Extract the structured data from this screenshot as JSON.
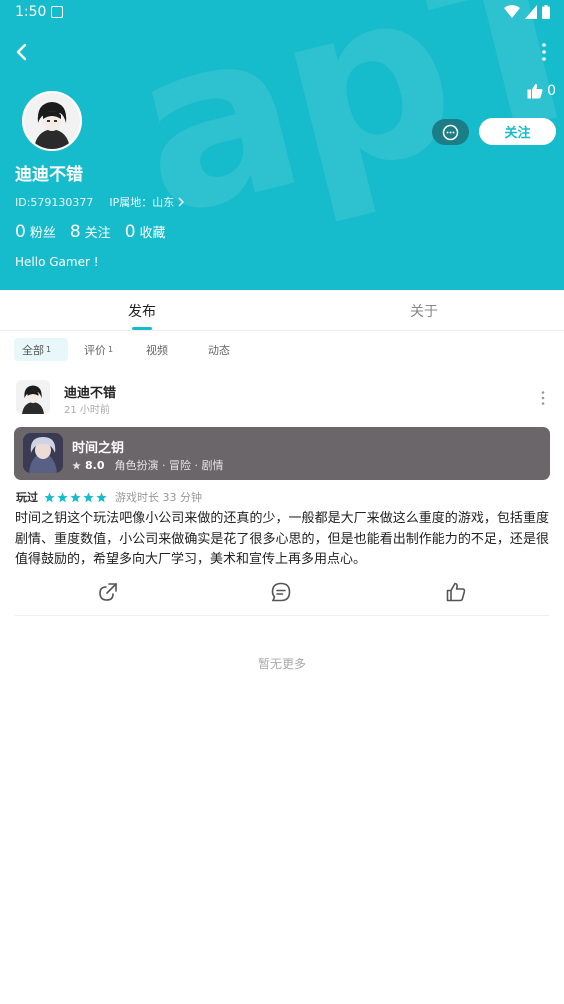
{
  "status_bar": {
    "time": "1:50"
  },
  "header": {
    "watermark": "apTap",
    "likes_count": "0",
    "follow_label": "关注",
    "username": "迪迪不错",
    "id_text": "ID:579130377",
    "ip_text": "IP属地：山东",
    "stats": [
      {
        "value": "0",
        "label": "粉丝"
      },
      {
        "value": "8",
        "label": "关注"
      },
      {
        "value": "0",
        "label": "收藏"
      }
    ],
    "bio": "Hello Gamer !"
  },
  "tabs": [
    {
      "label": "发布"
    },
    {
      "label": "关于"
    }
  ],
  "filters": [
    {
      "label": "全部",
      "count": "1"
    },
    {
      "label": "评价",
      "count": "1"
    },
    {
      "label": "视频",
      "count": ""
    },
    {
      "label": "动态",
      "count": ""
    }
  ],
  "post": {
    "author": "迪迪不错",
    "time": "21 小时前",
    "game": {
      "title": "时间之钥",
      "score": "8.0",
      "tags": "角色扮演 · 冒险 · 剧情"
    },
    "played_label": "玩过",
    "stars": 5,
    "playtime": "游戏时长 33 分钟",
    "text": "时间之钥这个玩法吧像小公司来做的还真的少，一般都是大厂来做这么重度的游戏，包括重度剧情、重度数值，小公司来做确实是花了很多心思的，但是也能看出制作能力的不足，还是很值得鼓励的，希望多向大厂学习，美术和宣传上再多用点心。"
  },
  "footer": {
    "no_more": "暂无更多"
  },
  "colors": {
    "accent": "#17bccc",
    "star": "#17bccc",
    "game_card": "#6b6669"
  }
}
